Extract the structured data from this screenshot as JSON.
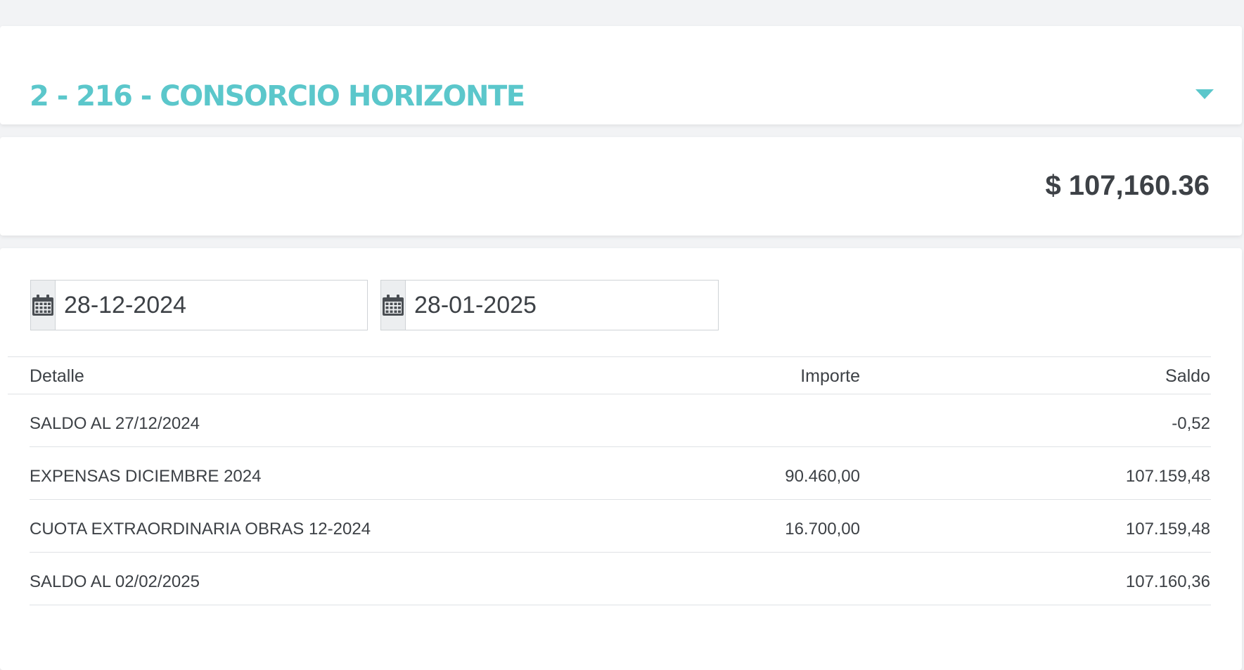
{
  "header": {
    "unit_title": "2 - 216 - CONSORCIO HORIZONTE",
    "accent_color": "#5bc7cb",
    "toggle_icon": "caret-down-icon"
  },
  "balance": {
    "amount": "$ 107,160.36"
  },
  "filters": {
    "date_from": {
      "value": "28-12-2024",
      "icon": "calendar-icon"
    },
    "date_to": {
      "value": "28-01-2025",
      "icon": "calendar-icon"
    }
  },
  "table": {
    "columns": {
      "detalle": "Detalle",
      "importe": "Importe",
      "saldo": "Saldo"
    },
    "rows": [
      {
        "detalle": "SALDO AL 27/12/2024",
        "importe": "",
        "saldo": "-0,52"
      },
      {
        "detalle": "EXPENSAS DICIEMBRE 2024",
        "importe": "90.460,00",
        "saldo": "107.159,48"
      },
      {
        "detalle": "CUOTA EXTRAORDINARIA OBRAS 12-2024",
        "importe": "16.700,00",
        "saldo": "107.159,48"
      },
      {
        "detalle": "SALDO AL 02/02/2025",
        "importe": "",
        "saldo": "107.160,36"
      }
    ]
  }
}
